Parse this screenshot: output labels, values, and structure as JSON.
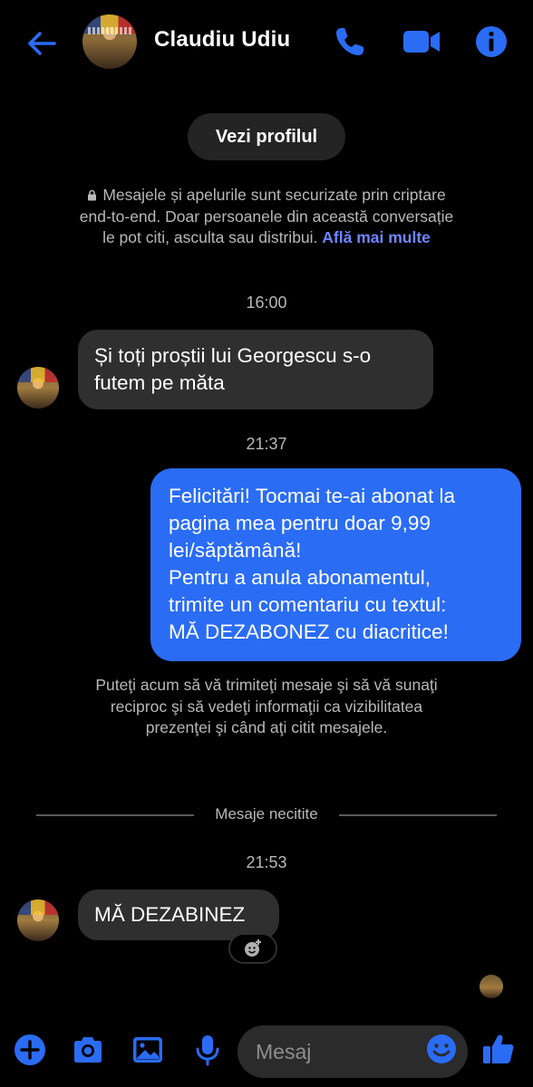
{
  "header": {
    "contact_name": "Claudiu Udiu",
    "accent_color": "#2a6cf4",
    "icons": [
      "back-arrow-icon",
      "phone-icon",
      "video-camera-icon",
      "info-icon"
    ]
  },
  "profile_button": {
    "label": "Vezi profilul"
  },
  "encryption_notice": {
    "text": "Mesajele și apelurile sunt securizate prin criptare end-to-end. Doar persoanele din această conversație le pot citi, asculta sau distribui.",
    "link_label": "Află mai multe"
  },
  "thread": {
    "time_1": "16:00",
    "msg_1_line1": "Și toți proștii lui Georgescu s-o",
    "msg_1_line2": "futem pe măta",
    "time_2": "21:37",
    "msg_2_lines": [
      "Felicitări! Tocmai te-ai abonat la",
      "pagina mea pentru doar 9,99",
      "lei/săptămână!",
      "Pentru a anula abonamentul,",
      "trimite un comentariu cu textul:",
      "MĂ DEZABONEZ cu diacritice!"
    ],
    "system_notice": "Puteţi acum să vă trimiteţi mesaje şi să vă sunaţi reciproc şi să vedeţi informaţii ca vizibilitatea prezenţei şi când aţi citit mesajele.",
    "unread_divider": "Mesaje necitite",
    "time_3": "21:53",
    "msg_3": "MĂ DEZABINEZ"
  },
  "composer": {
    "placeholder": "Mesaj",
    "icons": [
      "plus-icon",
      "camera-icon",
      "gallery-icon",
      "microphone-icon",
      "emoji-icon",
      "like-thumb-icon"
    ]
  }
}
